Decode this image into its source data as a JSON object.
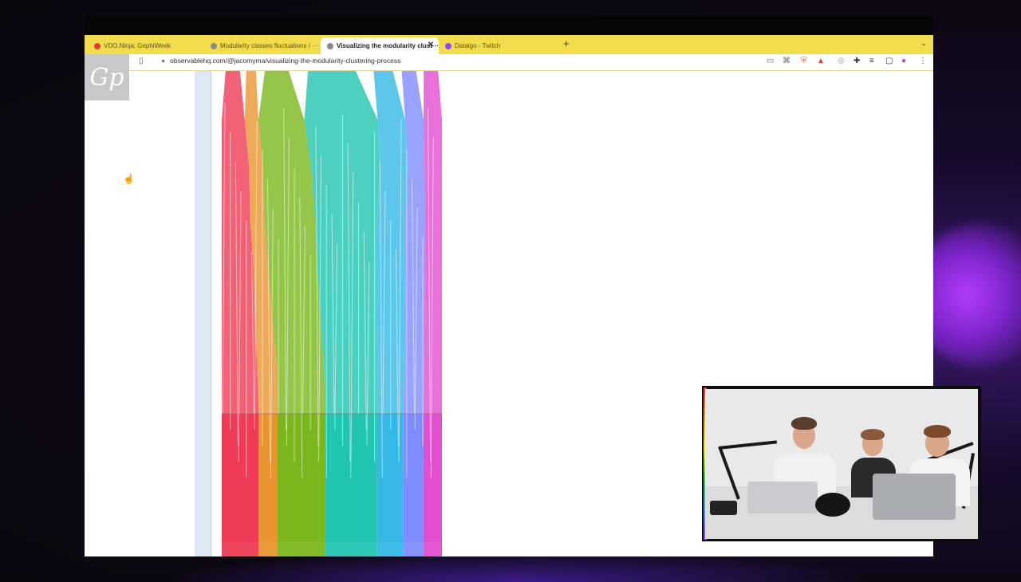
{
  "browser": {
    "tabs": [
      {
        "label": "VDO.Ninja: GephiWeek",
        "active": false,
        "favicon_color": "#e23b3b"
      },
      {
        "label": "Modularity classes fluctuations / ···",
        "active": false,
        "favicon_color": "#8a8a8a"
      },
      {
        "label": "Visualizing the modularity clust···",
        "active": true,
        "favicon_color": "#8a8a8a"
      },
      {
        "label": "Datalgo - Twitch",
        "active": false,
        "favicon_color": "#9146ff"
      }
    ],
    "new_tab_label": "+",
    "url": "observablehq.com/@jacomyma/visualizing-the-modularity-clustering-process"
  },
  "overlay": {
    "logo_text": "Gp"
  },
  "chart_data": {
    "type": "area",
    "title": "",
    "xlabel": "",
    "ylabel": "",
    "description_free": true,
    "series": [
      {
        "color": "#ef3b55",
        "values": [
          0.03,
          0.05,
          0.08,
          0.1,
          0.13,
          0.15,
          0.18,
          0.2
        ]
      },
      {
        "color": "#e8952f",
        "values": [
          0.02,
          0.03,
          0.04,
          0.05,
          0.06,
          0.08,
          0.1,
          0.1
        ]
      },
      {
        "color": "#7bb61c",
        "values": [
          0.05,
          0.1,
          0.14,
          0.18,
          0.2,
          0.22,
          0.24,
          0.26
        ]
      },
      {
        "color": "#20c4b0",
        "values": [
          0.1,
          0.16,
          0.2,
          0.22,
          0.24,
          0.26,
          0.27,
          0.28
        ]
      },
      {
        "color": "#35b8e6",
        "values": [
          0.04,
          0.06,
          0.08,
          0.1,
          0.12,
          0.13,
          0.14,
          0.14
        ]
      },
      {
        "color": "#7f8cff",
        "values": [
          0.03,
          0.04,
          0.05,
          0.07,
          0.08,
          0.09,
          0.1,
          0.11
        ]
      },
      {
        "color": "#e24ecf",
        "values": [
          0.03,
          0.04,
          0.05,
          0.06,
          0.07,
          0.08,
          0.09,
          0.1
        ]
      }
    ]
  }
}
